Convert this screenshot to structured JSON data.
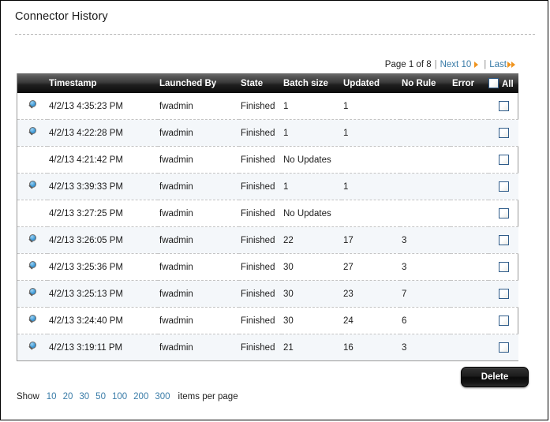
{
  "page": {
    "title": "Connector History"
  },
  "pager": {
    "page_text": "Page 1 of 8",
    "separator": "|",
    "next_label": "Next 10",
    "last_label": "Last"
  },
  "table": {
    "columns": [
      {
        "key": "icon",
        "label": ""
      },
      {
        "key": "timestamp",
        "label": "Timestamp"
      },
      {
        "key": "launched_by",
        "label": "Launched By"
      },
      {
        "key": "state",
        "label": "State"
      },
      {
        "key": "batch_size",
        "label": "Batch size"
      },
      {
        "key": "updated",
        "label": "Updated"
      },
      {
        "key": "no_rule",
        "label": "No Rule"
      },
      {
        "key": "error",
        "label": "Error"
      },
      {
        "key": "all",
        "label": "All"
      }
    ],
    "rows": [
      {
        "icon": true,
        "timestamp": "4/2/13 4:35:23 PM",
        "launched_by": "fwadmin",
        "state": "Finished",
        "batch_size": "1",
        "updated": "1",
        "no_rule": "",
        "error": "",
        "checked": false
      },
      {
        "icon": true,
        "timestamp": "4/2/13 4:22:28 PM",
        "launched_by": "fwadmin",
        "state": "Finished",
        "batch_size": "1",
        "updated": "1",
        "no_rule": "",
        "error": "",
        "checked": false
      },
      {
        "icon": false,
        "timestamp": "4/2/13 4:21:42 PM",
        "launched_by": "fwadmin",
        "state": "Finished",
        "batch_size": "No Updates",
        "updated": "",
        "no_rule": "",
        "error": "",
        "checked": false
      },
      {
        "icon": true,
        "timestamp": "4/2/13 3:39:33 PM",
        "launched_by": "fwadmin",
        "state": "Finished",
        "batch_size": "1",
        "updated": "1",
        "no_rule": "",
        "error": "",
        "checked": false
      },
      {
        "icon": false,
        "timestamp": "4/2/13 3:27:25 PM",
        "launched_by": "fwadmin",
        "state": "Finished",
        "batch_size": "No Updates",
        "updated": "",
        "no_rule": "",
        "error": "",
        "checked": false
      },
      {
        "icon": true,
        "timestamp": "4/2/13 3:26:05 PM",
        "launched_by": "fwadmin",
        "state": "Finished",
        "batch_size": "22",
        "updated": "17",
        "no_rule": "3",
        "error": "",
        "checked": false
      },
      {
        "icon": true,
        "timestamp": "4/2/13 3:25:36 PM",
        "launched_by": "fwadmin",
        "state": "Finished",
        "batch_size": "30",
        "updated": "27",
        "no_rule": "3",
        "error": "",
        "checked": false
      },
      {
        "icon": true,
        "timestamp": "4/2/13 3:25:13 PM",
        "launched_by": "fwadmin",
        "state": "Finished",
        "batch_size": "30",
        "updated": "23",
        "no_rule": "7",
        "error": "",
        "checked": false
      },
      {
        "icon": true,
        "timestamp": "4/2/13 3:24:40 PM",
        "launched_by": "fwadmin",
        "state": "Finished",
        "batch_size": "30",
        "updated": "24",
        "no_rule": "6",
        "error": "",
        "checked": false
      },
      {
        "icon": true,
        "timestamp": "4/2/13 3:19:11 PM",
        "launched_by": "fwadmin",
        "state": "Finished",
        "batch_size": "21",
        "updated": "16",
        "no_rule": "3",
        "error": "",
        "checked": false
      }
    ]
  },
  "actions": {
    "delete_label": "Delete"
  },
  "show_per_page": {
    "lead_label": "Show",
    "sizes": [
      "10",
      "20",
      "30",
      "50",
      "100",
      "200",
      "300"
    ],
    "trail_label": "items per page"
  },
  "colors": {
    "link": "#3a7ca8",
    "arrow": "#f0941e",
    "header_bg": "#1f1f1f",
    "alt_row": "#f4f7fa",
    "checkbox_border": "#2f5c8a"
  }
}
